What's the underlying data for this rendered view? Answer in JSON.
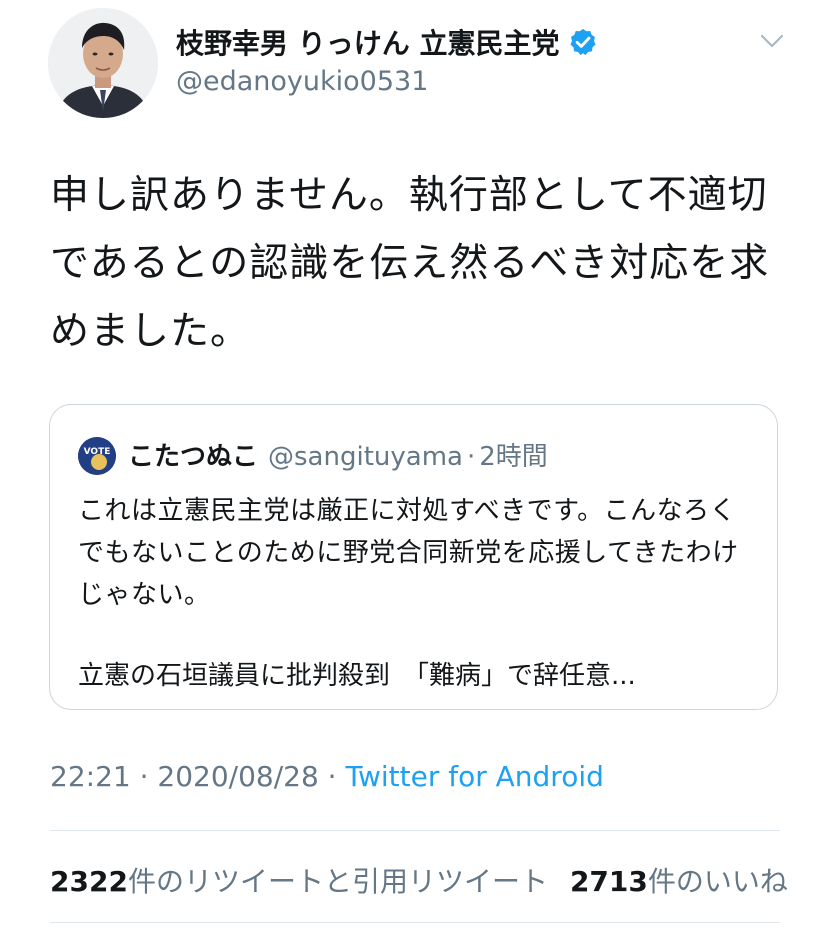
{
  "tweet": {
    "author": {
      "display_name": "枝野幸男 りっけん 立憲民主党",
      "handle": "@edanoyukio0531",
      "verified": true
    },
    "text": "申し訳ありません。執行部として不適切であるとの認識を伝え然るべき対応を求めました。",
    "quoted": {
      "display_name": "こたつぬこ",
      "handle": "@sangituyama",
      "separator": "·",
      "time": "2時間",
      "avatar_text": "VOTE",
      "text": "これは立憲民主党は厳正に対処すべきです。こんなろくでもないことのために野党合同新党を応援してきたわけじゃない。",
      "link_preview": "立憲の石垣議員に批判殺到　「難病」で辞任意..."
    },
    "timestamp": "22:21 · 2020/08/28 · ",
    "source": "Twitter for Android",
    "stats": {
      "retweets_count": "2322",
      "retweets_label": "件のリツイートと引用リツイート",
      "likes_count": "2713",
      "likes_label": "件のいいね"
    }
  },
  "colors": {
    "accent": "#1da1f2",
    "verified_badge": "#1da1f2",
    "secondary_text": "#657786",
    "border": "#ccd6dd",
    "divider": "#e1e8ed"
  },
  "icons": {
    "verified": "verified-badge-icon",
    "caret": "chevron-down-icon"
  }
}
